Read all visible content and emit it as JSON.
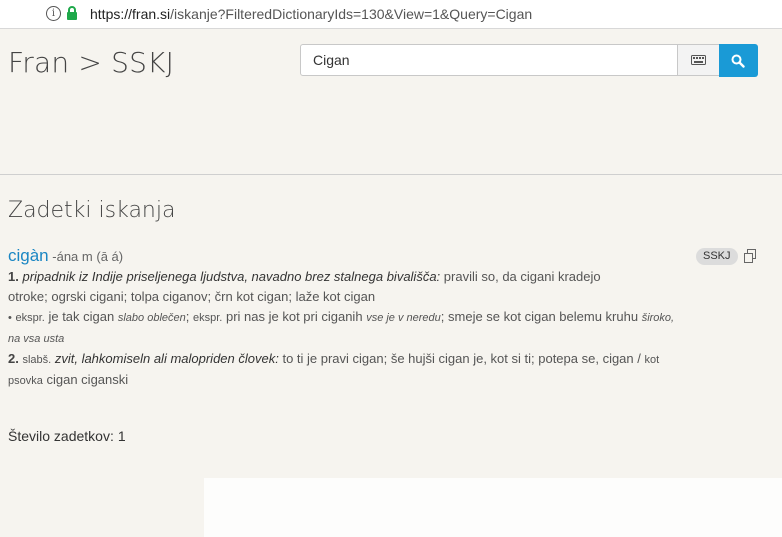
{
  "browser": {
    "url_host": "https://fran.si",
    "url_rest": "/iskanje?FilteredDictionaryIds=130&View=1&Query=Cigan"
  },
  "header": {
    "brand": "Fran > SSKJ",
    "search_value": "Cigan",
    "accent_color": "#1a9ad6"
  },
  "results": {
    "heading": "Zadetki iskanja",
    "count_label": "Število zadetkov:",
    "count_value": "1"
  },
  "entry": {
    "headword": "cigàn",
    "grammar": "-ána m",
    "accent": "(ā á)",
    "badge": "SSKJ",
    "sense1": {
      "num": "1.",
      "definition": "pripadnik iz Indije priseljenega ljudstva, navadno brez stalnega bivališča:",
      "examples1": "pravili so, da cigani kradejo",
      "examples2": "otroke; ogrski cigani; tolpa ciganov; črn kot cigan; laže kot cigan",
      "bullet": "•",
      "q1": "ekspr.",
      "ex1": "je tak cigan",
      "gloss1": "slabo oblečen",
      "sep1": ";",
      "q2": "ekspr.",
      "ex2": "pri nas je kot pri ciganih",
      "gloss2": "vse je v neredu",
      "ex3": "; smeje se kot cigan belemu kruhu",
      "gloss3a": "široko,",
      "gloss3b": "na vsa usta"
    },
    "sense2": {
      "num": "2.",
      "qualifier": "slabš.",
      "definition": "zvit, lahkomiseln ali malopriden človek:",
      "examples": "to ti je pravi cigan; še hujši cigan je, kot si ti; potepa se, cigan /",
      "q1": "kot",
      "q2": "psovka",
      "tail": "cigan ciganski"
    }
  }
}
